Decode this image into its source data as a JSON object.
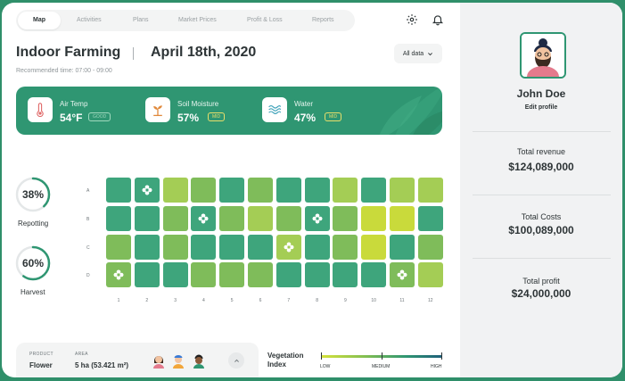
{
  "nav": {
    "tabs": [
      "Map",
      "Activities",
      "Plans",
      "Market Prices",
      "Profit & Loss",
      "Reports"
    ],
    "active_index": 0
  },
  "header": {
    "title": "Indoor Farming",
    "date": "April 18th, 2020",
    "recommended_time": "Recommended time: 07:00 - 09:00",
    "filter_label": "All data"
  },
  "metrics": [
    {
      "label": "Air Temp",
      "value": "54°F",
      "badge": "GOOD",
      "icon": "thermometer-icon"
    },
    {
      "label": "Soil Moisture",
      "value": "57%",
      "badge": "MID",
      "icon": "sprout-icon"
    },
    {
      "label": "Water",
      "value": "47%",
      "badge": "MID",
      "icon": "water-waves-icon"
    }
  ],
  "rings": [
    {
      "label": "Repotting",
      "value": "38%",
      "fraction": 0.38
    },
    {
      "label": "Harvest",
      "value": "60%",
      "fraction": 0.6
    }
  ],
  "grid": {
    "rows": [
      "A",
      "B",
      "C",
      "D"
    ],
    "cols": [
      "1",
      "2",
      "3",
      "4",
      "5",
      "6",
      "7",
      "8",
      "9",
      "10",
      "11",
      "12"
    ],
    "levels": [
      [
        3,
        3,
        1,
        2,
        3,
        2,
        3,
        3,
        1,
        3,
        1,
        1
      ],
      [
        3,
        3,
        2,
        3,
        2,
        1,
        2,
        3,
        2,
        0,
        0,
        3
      ],
      [
        2,
        3,
        2,
        3,
        3,
        3,
        1,
        3,
        2,
        0,
        3,
        2
      ],
      [
        2,
        3,
        3,
        2,
        2,
        2,
        3,
        3,
        3,
        3,
        2,
        1
      ]
    ],
    "flowers": [
      [
        0,
        1
      ],
      [
        1,
        3
      ],
      [
        1,
        7
      ],
      [
        2,
        6
      ],
      [
        3,
        0
      ],
      [
        3,
        10
      ]
    ],
    "level_colors": [
      "#c9da3b",
      "#a4cd55",
      "#7fbc5a",
      "#3ea57c"
    ]
  },
  "bottom": {
    "product_label": "PRODUCT",
    "product_value": "Flower",
    "area_label": "AREA",
    "area_value": "5 ha (53.421 m²)"
  },
  "vegetation": {
    "title_line1": "Vegetation",
    "title_line2": "Index",
    "low": "LOW",
    "medium": "MEDIUM",
    "high": "HIGH"
  },
  "profile": {
    "name": "John Doe",
    "edit_label": "Edit profile"
  },
  "stats": [
    {
      "label": "Total revenue",
      "value": "$124,089,000"
    },
    {
      "label": "Total Costs",
      "value": "$100,089,000"
    },
    {
      "label": "Total profit",
      "value": "$24,000,000"
    }
  ],
  "colors": {
    "accent": "#2f9672",
    "text": "#2d3436"
  }
}
